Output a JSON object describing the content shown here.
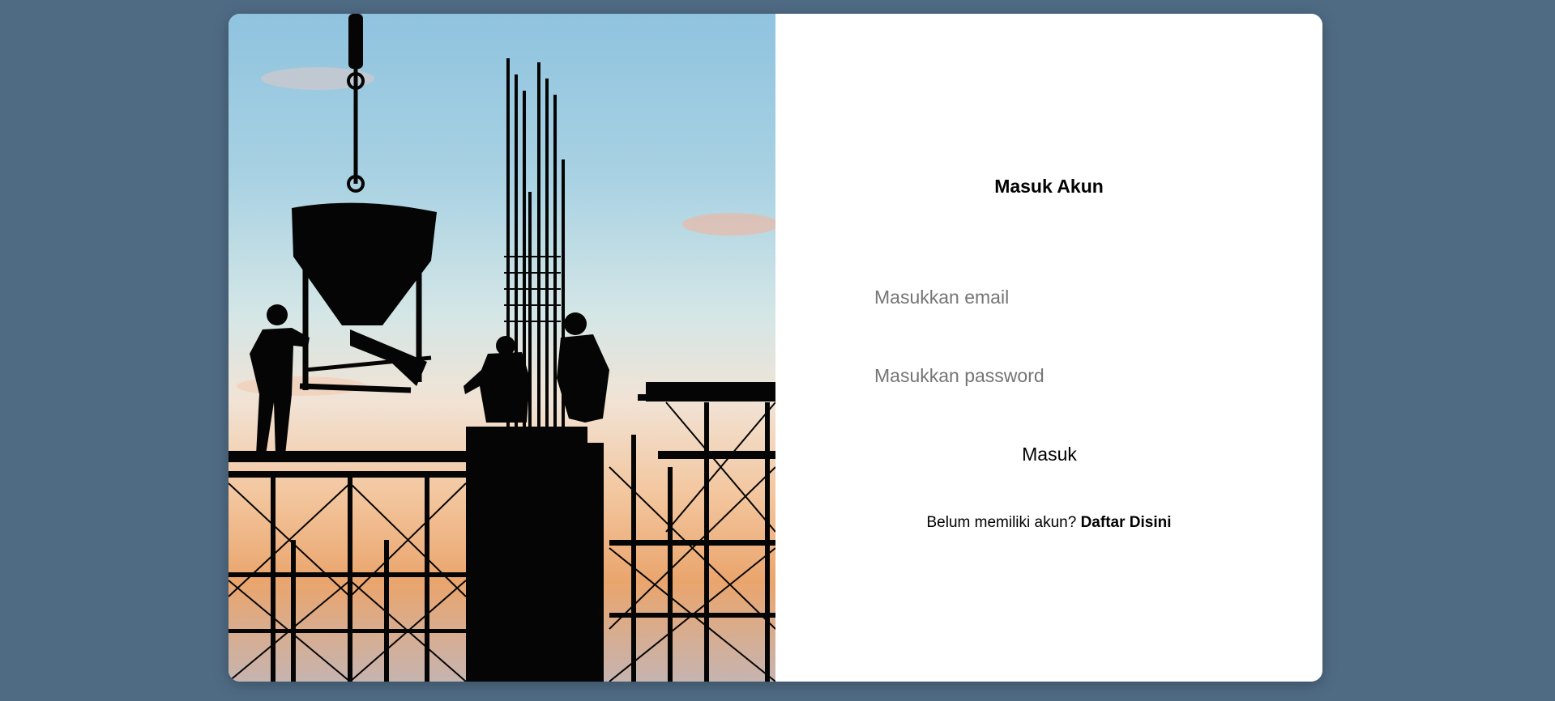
{
  "login": {
    "title": "Masuk Akun",
    "email_placeholder": "Masukkan email",
    "password_placeholder": "Masukkan password",
    "submit_label": "Masuk",
    "register_prompt": "Belum memiliki akun?",
    "register_link": "Daftar Disini"
  },
  "image": {
    "subject": "construction-site-silhouette"
  },
  "colors": {
    "background": "#4f6b84",
    "card": "#ffffff",
    "text": "#000000",
    "placeholder": "#757575"
  }
}
